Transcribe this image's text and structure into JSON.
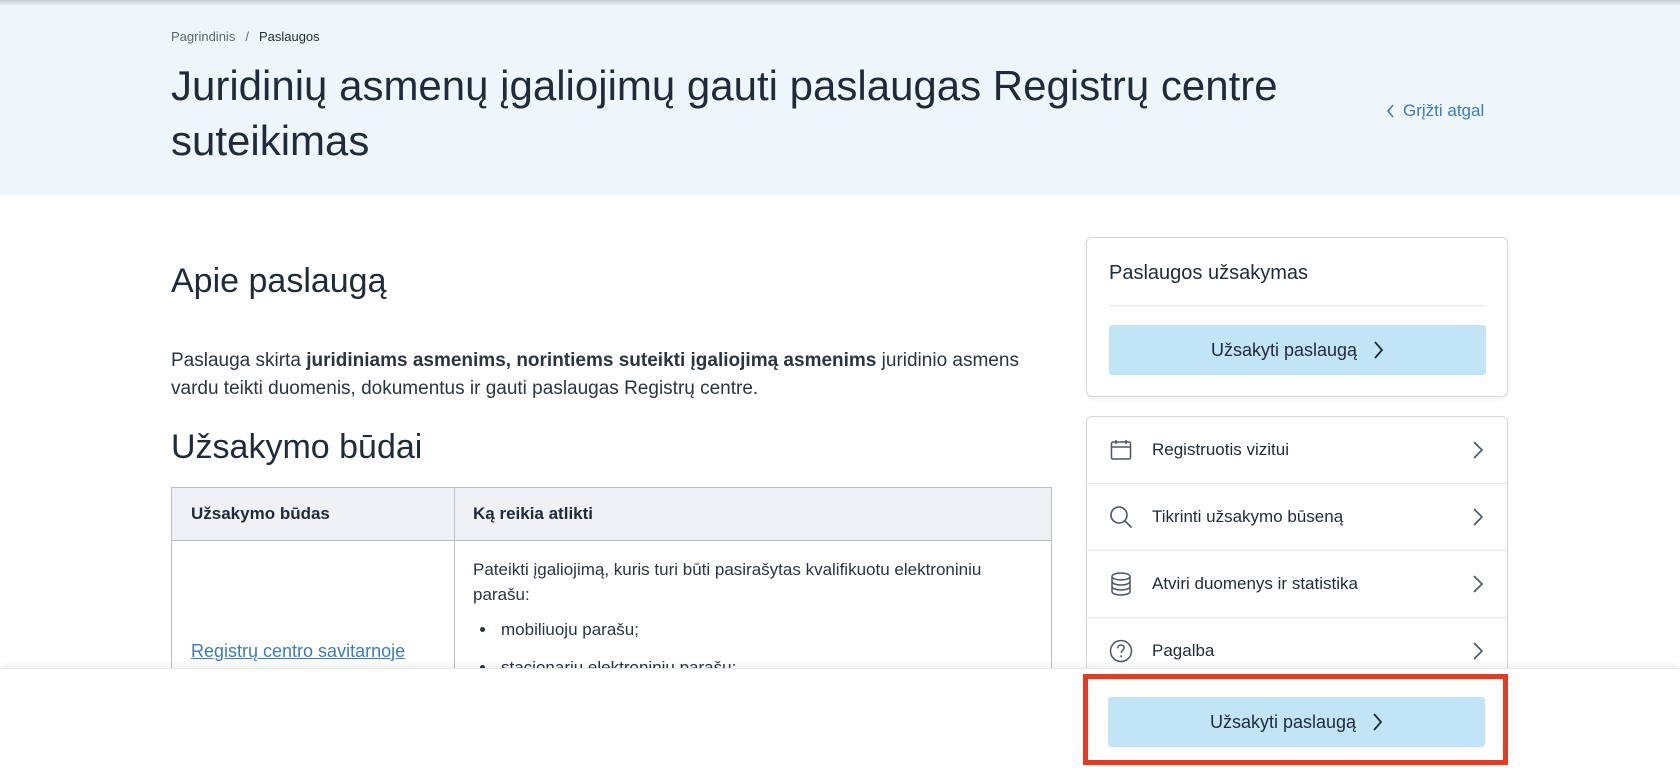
{
  "breadcrumb": {
    "home": "Pagrindinis",
    "separator": "/",
    "current": "Paslaugos"
  },
  "page_title": "Juridinių asmenų įgaliojimų gauti paslaugas Registrų centre suteikimas",
  "back_link": "Grįžti atgal",
  "about": {
    "heading": "Apie paslaugą",
    "text_before": "Paslauga skirta ",
    "text_bold": "juridiniams asmenims, norintiems suteikti įgaliojimą asmenims",
    "text_after": " juridinio asmens vardu teikti duomenis, dokumentus ir gauti paslaugas Registrų centre."
  },
  "ways": {
    "heading": "Užsakymo būdai",
    "columns": [
      "Užsakymo būdas",
      "Ką reikia atlikti"
    ],
    "rows": [
      {
        "method": "Registrų centro savitarnoje",
        "description": "Pateikti įgaliojimą, kuris turi būti pasirašytas kvalifikuotu elektroniniu parašu:",
        "items": [
          "mobiliuoju parašu;",
          "stacionariu elektroniniu parašu;"
        ]
      }
    ]
  },
  "order_card": {
    "title": "Paslaugos užsakymas",
    "button": "Užsakyti paslaugą"
  },
  "links": [
    {
      "label": "Registruotis vizitui",
      "icon": "calendar-icon"
    },
    {
      "label": "Tikrinti užsakymo būseną",
      "icon": "search-icon"
    },
    {
      "label": "Atviri duomenys ir statistika",
      "icon": "database-icon"
    },
    {
      "label": "Pagalba",
      "icon": "help-icon"
    }
  ],
  "sticky": {
    "button": "Užsakyti paslaugą"
  },
  "colors": {
    "accent_button": "#c1e4f7",
    "link": "#3b7cb8",
    "hero_bg": "#eef6fb",
    "highlight": "#e53b23"
  }
}
